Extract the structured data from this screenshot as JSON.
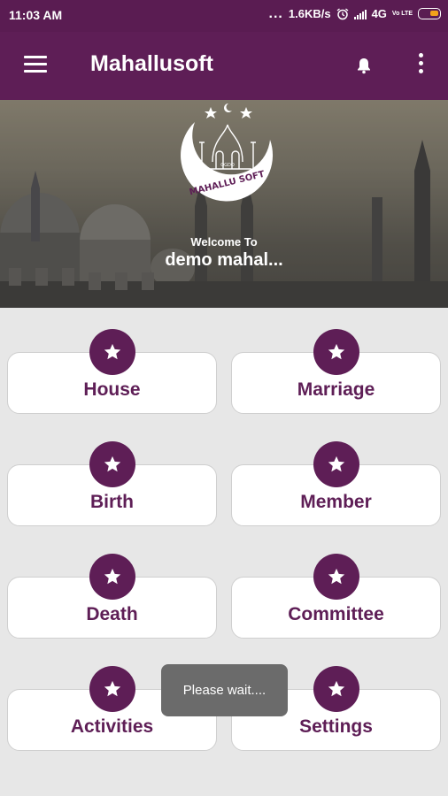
{
  "status_bar": {
    "time": "11:03 AM",
    "more": "...",
    "speed": "1.6KB/s",
    "network": "4G",
    "volte": "Vo LTE",
    "battery_color": "#f2a21a"
  },
  "app_bar": {
    "menu_icon": "hamburger-menu-icon",
    "title": "Mahallusoft",
    "notification_icon": "bell-icon",
    "overflow_icon": "vertical-dots-icon",
    "color": "#5e1e56"
  },
  "header": {
    "logo_text": "MAHALLU SOFT",
    "logo_small_text": "OGDO",
    "welcome": "Welcome To",
    "mahal_name": "demo mahal..."
  },
  "menu": {
    "items": [
      {
        "label": "House",
        "icon": "star-icon"
      },
      {
        "label": "Marriage",
        "icon": "star-icon"
      },
      {
        "label": "Birth",
        "icon": "star-icon"
      },
      {
        "label": "Member",
        "icon": "star-icon"
      },
      {
        "label": "Death",
        "icon": "star-icon"
      },
      {
        "label": "Committee",
        "icon": "star-icon"
      },
      {
        "label": "Activities",
        "icon": "star-icon"
      },
      {
        "label": "Settings",
        "icon": "star-icon"
      }
    ]
  },
  "toast": {
    "message": "Please wait...."
  }
}
